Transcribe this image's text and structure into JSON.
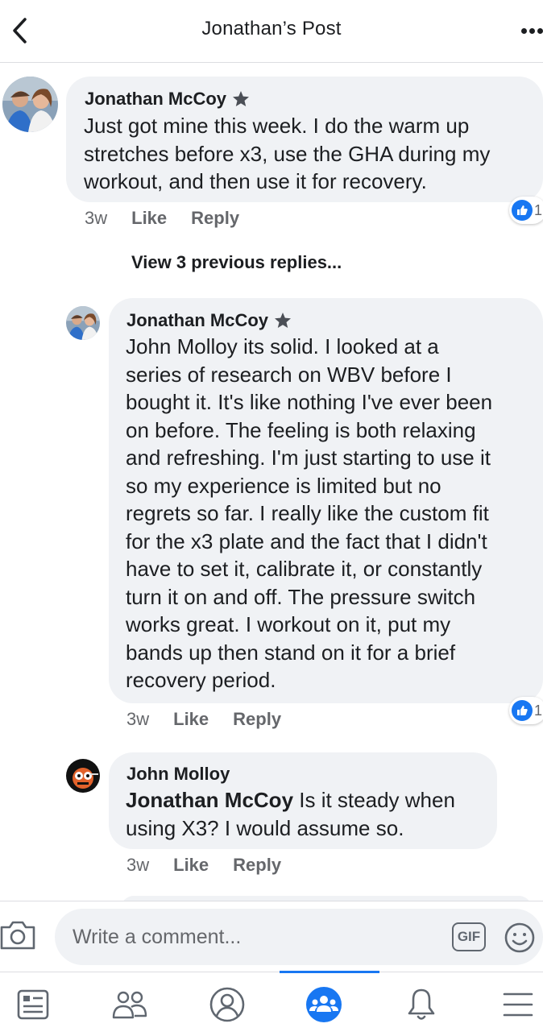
{
  "header": {
    "title": "Jonathan’s Post",
    "back_icon": "chevron-left-icon",
    "more_icon": "more-horizontal-icon"
  },
  "colors": {
    "accent": "#1877f2",
    "bubble": "#f0f2f5",
    "secondary_text": "#65676b"
  },
  "comments": [
    {
      "author": "Jonathan McCoy",
      "badge_icon": "top-fan-star-icon",
      "text": "Just got mine this week.  I do the warm up\nstretches before x3, use the GHA during my\nworkout, and then use it for recovery.",
      "time": "3w",
      "like_label": "Like",
      "reply_label": "Reply",
      "reaction_count": "1"
    }
  ],
  "view_previous_replies": "View 3 previous replies...",
  "replies": [
    {
      "author": "Jonathan McCoy",
      "badge_icon": "top-fan-star-icon",
      "text": "John Molloy its solid. I looked at a\nseries of research on WBV before I\nbought it. It's like nothing I've ever been\non before.  The feeling is both relaxing\nand refreshing. I'm just starting to use it\nso my experience is limited but no\nregrets so far. I really like the custom fit\nfor the x3 plate and the fact that I didn't\nhave to set it, calibrate it, or constantly\nturn it on and off. The pressure switch\nworks great. I workout on it, put my\nbands up then stand on it for a brief\nrecovery period.",
      "time": "3w",
      "like_label": "Like",
      "reply_label": "Reply",
      "reaction_count": "1"
    },
    {
      "author": "John Molloy",
      "mention": "Jonathan McCoy",
      "text": " Is it steady when\nusing X3? I would assume so.",
      "time": "3w",
      "like_label": "Like",
      "reply_label": "Reply"
    }
  ],
  "composer": {
    "placeholder": "Write a comment...",
    "gif_label": "GIF",
    "camera_icon": "camera-icon",
    "emoji_icon": "smiley-icon"
  },
  "tabbar": {
    "active_tab": "groups",
    "tabs": [
      "news-feed-icon",
      "friends-icon",
      "profile-icon",
      "groups-icon",
      "notifications-bell-icon",
      "menu-icon"
    ]
  }
}
